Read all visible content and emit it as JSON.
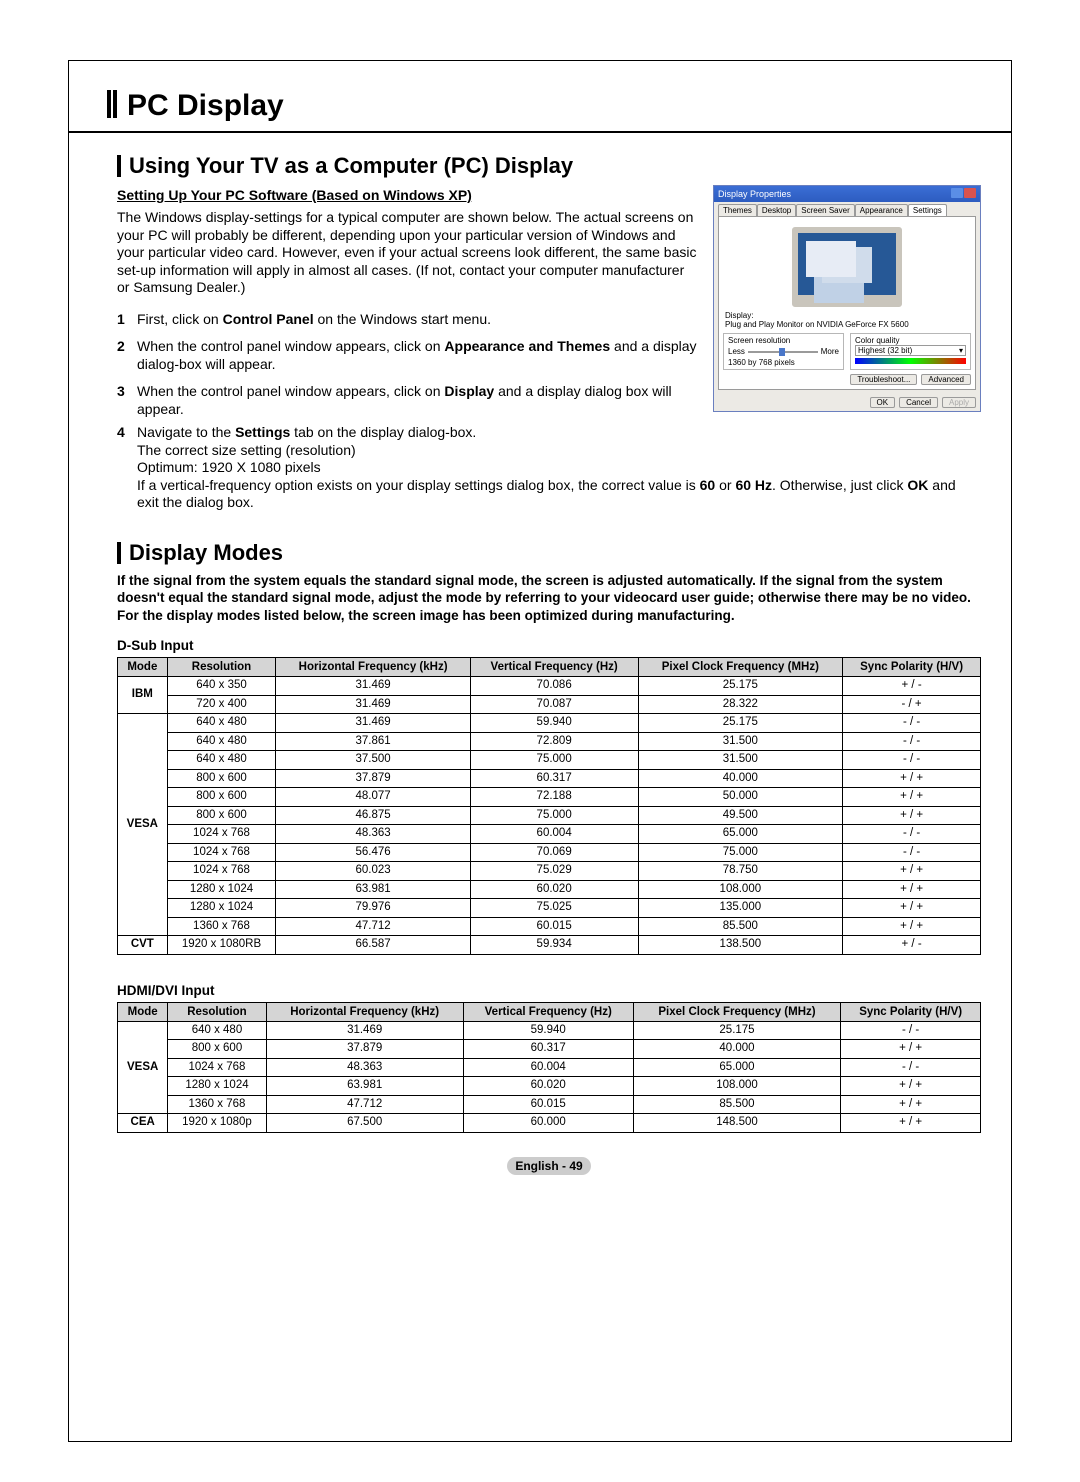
{
  "page_title": "PC Display",
  "section1_title": "Using Your TV as a Computer (PC) Display",
  "section1_sub": "Setting Up Your PC Software (Based on Windows XP)",
  "intro_para": "The Windows display-settings for a typical computer are shown below. The actual screens on your PC will probably be different, depending upon your particular version of Windows and your particular video card. However, even if your actual screens look different, the same basic set-up information will apply in almost all cases. (If not, contact your computer manufacturer or Samsung Dealer.)",
  "steps": {
    "s1_num": "1",
    "s1_a": "First, click on ",
    "s1_b": "Control Panel",
    "s1_c": " on the Windows start menu.",
    "s2_num": "2",
    "s2_a": "When the control panel window appears, click on ",
    "s2_b": "Appearance and Themes",
    "s2_c": " and a display dialog-box will appear.",
    "s3_num": "3",
    "s3_a": "When the control panel window appears, click on ",
    "s3_b": "Display",
    "s3_c": " and a display dialog box will appear.",
    "s4_num": "4",
    "s4_a": "Navigate to the ",
    "s4_b": "Settings",
    "s4_c": " tab on the display dialog-box.",
    "s4_d": "The correct size setting (resolution)",
    "s4_e": "Optimum: 1920 X 1080 pixels",
    "s4_f1": "If a vertical-frequency option exists on your display settings dialog box, the correct value is ",
    "s4_f2": "60",
    "s4_f3": " or ",
    "s4_f4": "60 Hz",
    "s4_f5": ". Otherwise, just click ",
    "s4_f6": "OK",
    "s4_f7": " and exit the dialog box."
  },
  "section2_title": "Display Modes",
  "section2_note": "If the signal from the system equals the standard signal mode, the screen is adjusted automatically. If the signal from the system doesn't equal the standard signal mode, adjust the mode by referring to your videocard user guide; otherwise there may be no video. For the display modes listed below, the screen image has been optimized during manufacturing.",
  "table_headers": {
    "mode": "Mode",
    "res": "Resolution",
    "hf": "Horizontal Frequency (kHz)",
    "vf": "Vertical Frequency (Hz)",
    "pc": "Pixel Clock Frequency (MHz)",
    "sp": "Sync Polarity (H/V)"
  },
  "dsub_title": "D-Sub Input",
  "dsub_groups": [
    {
      "mode": "IBM",
      "rows": [
        {
          "res": "640 x 350",
          "hf": "31.469",
          "vf": "70.086",
          "pc": "25.175",
          "sp": "+ / -"
        },
        {
          "res": "720 x 400",
          "hf": "31.469",
          "vf": "70.087",
          "pc": "28.322",
          "sp": "- / +"
        }
      ]
    },
    {
      "mode": "VESA",
      "rows": [
        {
          "res": "640 x 480",
          "hf": "31.469",
          "vf": "59.940",
          "pc": "25.175",
          "sp": "- / -"
        },
        {
          "res": "640 x 480",
          "hf": "37.861",
          "vf": "72.809",
          "pc": "31.500",
          "sp": "- / -"
        },
        {
          "res": "640 x 480",
          "hf": "37.500",
          "vf": "75.000",
          "pc": "31.500",
          "sp": "- / -"
        },
        {
          "res": "800 x 600",
          "hf": "37.879",
          "vf": "60.317",
          "pc": "40.000",
          "sp": "+ / +"
        },
        {
          "res": "800 x 600",
          "hf": "48.077",
          "vf": "72.188",
          "pc": "50.000",
          "sp": "+ / +"
        },
        {
          "res": "800 x 600",
          "hf": "46.875",
          "vf": "75.000",
          "pc": "49.500",
          "sp": "+ / +"
        },
        {
          "res": "1024 x 768",
          "hf": "48.363",
          "vf": "60.004",
          "pc": "65.000",
          "sp": "- / -"
        },
        {
          "res": "1024 x 768",
          "hf": "56.476",
          "vf": "70.069",
          "pc": "75.000",
          "sp": "- / -"
        },
        {
          "res": "1024 x 768",
          "hf": "60.023",
          "vf": "75.029",
          "pc": "78.750",
          "sp": "+ / +"
        },
        {
          "res": "1280 x 1024",
          "hf": "63.981",
          "vf": "60.020",
          "pc": "108.000",
          "sp": "+ / +"
        },
        {
          "res": "1280 x 1024",
          "hf": "79.976",
          "vf": "75.025",
          "pc": "135.000",
          "sp": "+ / +"
        },
        {
          "res": "1360 x 768",
          "hf": "47.712",
          "vf": "60.015",
          "pc": "85.500",
          "sp": "+ / +"
        }
      ]
    },
    {
      "mode": "CVT",
      "rows": [
        {
          "res": "1920 x 1080RB",
          "hf": "66.587",
          "vf": "59.934",
          "pc": "138.500",
          "sp": "+ / -"
        }
      ]
    }
  ],
  "hdmi_title": "HDMI/DVI Input",
  "hdmi_groups": [
    {
      "mode": "VESA",
      "rows": [
        {
          "res": "640 x 480",
          "hf": "31.469",
          "vf": "59.940",
          "pc": "25.175",
          "sp": "- / -"
        },
        {
          "res": "800 x 600",
          "hf": "37.879",
          "vf": "60.317",
          "pc": "40.000",
          "sp": "+ / +"
        },
        {
          "res": "1024 x 768",
          "hf": "48.363",
          "vf": "60.004",
          "pc": "65.000",
          "sp": "- / -"
        },
        {
          "res": "1280 x 1024",
          "hf": "63.981",
          "vf": "60.020",
          "pc": "108.000",
          "sp": "+ / +"
        },
        {
          "res": "1360 x 768",
          "hf": "47.712",
          "vf": "60.015",
          "pc": "85.500",
          "sp": "+ / +"
        }
      ]
    },
    {
      "mode": "CEA",
      "rows": [
        {
          "res": "1920 x 1080p",
          "hf": "67.500",
          "vf": "60.000",
          "pc": "148.500",
          "sp": "+ / +"
        }
      ]
    }
  ],
  "footer": "English - 49",
  "xp": {
    "title": "Display Properties",
    "tabs": [
      "Themes",
      "Desktop",
      "Screen Saver",
      "Appearance",
      "Settings"
    ],
    "display_label": "Display:",
    "display_name": "Plug and Play Monitor on NVIDIA GeForce FX 5600",
    "group_res": "Screen resolution",
    "less": "Less",
    "more": "More",
    "res_value": "1360 by 768 pixels",
    "group_color": "Color quality",
    "color_value": "Highest (32 bit)",
    "troubleshoot": "Troubleshoot...",
    "advanced": "Advanced",
    "ok": "OK",
    "cancel": "Cancel",
    "apply": "Apply"
  }
}
